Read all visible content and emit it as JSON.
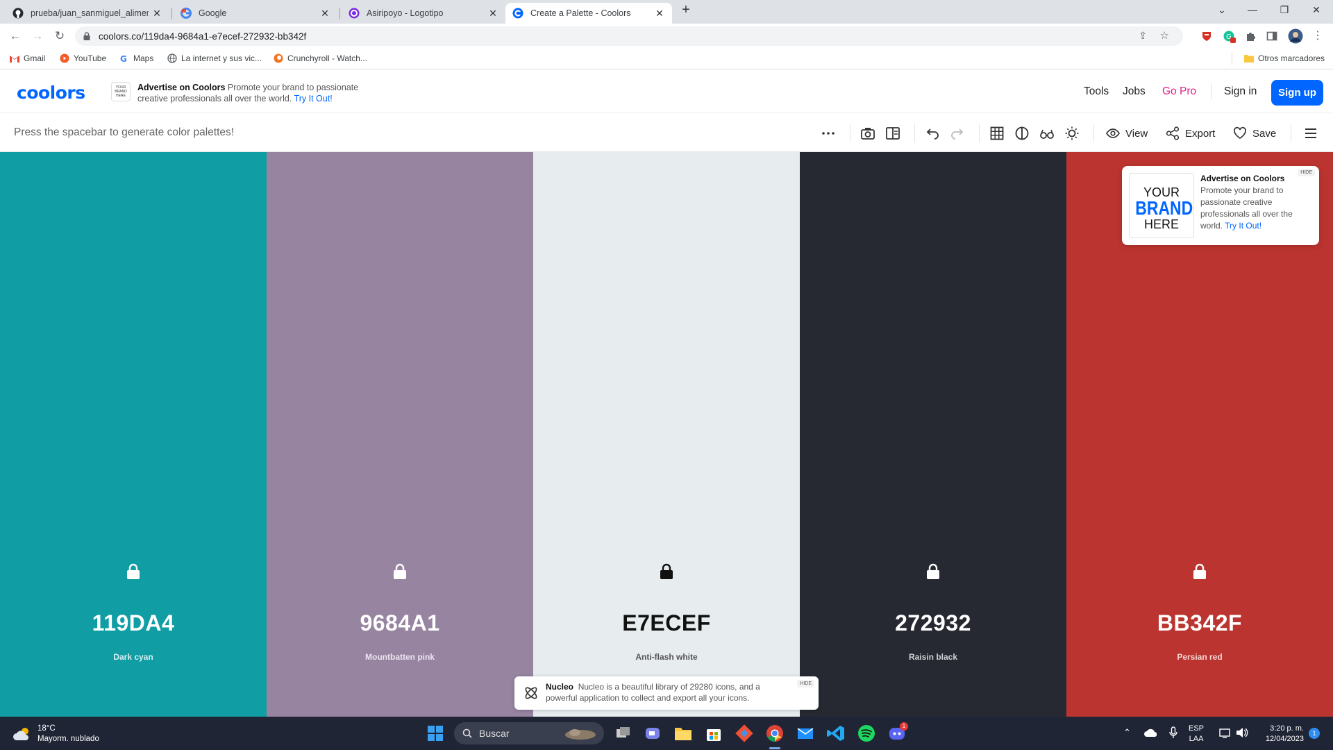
{
  "browser": {
    "tabs": [
      {
        "title": "prueba/juan_sanmiguel_alimentos",
        "icon": "github-icon",
        "active": false
      },
      {
        "title": "Google",
        "icon": "google-icon",
        "active": false
      },
      {
        "title": "Asiripoyo - Logotipo",
        "icon": "canva-icon",
        "active": false
      },
      {
        "title": "Create a Palette - Coolors",
        "icon": "coolors-icon",
        "active": true
      }
    ],
    "new_tab_label": "+",
    "url": "coolors.co/119da4-9684a1-e7ecef-272932-bb342f",
    "bookmarks": [
      {
        "label": "Gmail",
        "icon": "gmail-icon"
      },
      {
        "label": "YouTube",
        "icon": "youtube-icon"
      },
      {
        "label": "Maps",
        "icon": "maps-icon"
      },
      {
        "label": "La internet y sus vic...",
        "icon": "globe-icon"
      },
      {
        "label": "Crunchyroll - Watch...",
        "icon": "crunchyroll-icon"
      }
    ],
    "other_bookmarks": "Otros marcadores"
  },
  "header": {
    "logo": "coolors",
    "ad_box_text": "YOUR BRAND HERE",
    "ad_title": "Advertise on Coolors",
    "ad_text": "Promote your brand to passionate creative professionals all over the world.",
    "ad_link": "Try It Out!",
    "nav": {
      "tools": "Tools",
      "jobs": "Jobs",
      "gopro": "Go Pro",
      "signin": "Sign in",
      "signup": "Sign up"
    }
  },
  "toolbar": {
    "hint": "Press the spacebar to generate color palettes!",
    "view": "View",
    "export": "Export",
    "save": "Save"
  },
  "palette": [
    {
      "hex": "119DA4",
      "name": "Dark cyan",
      "color": "#119da4",
      "text_color": "#ffffff",
      "name_color": "#d8f0f1"
    },
    {
      "hex": "9684A1",
      "name": "Mountbatten pink",
      "color": "#9684a1",
      "text_color": "#ffffff",
      "name_color": "#ece6f0"
    },
    {
      "hex": "E7ECEF",
      "name": "Anti-flash white",
      "color": "#e7ecef",
      "text_color": "#111111",
      "name_color": "#555555"
    },
    {
      "hex": "272932",
      "name": "Raisin black",
      "color": "#272932",
      "text_color": "#ffffff",
      "name_color": "#d0d1d6"
    },
    {
      "hex": "BB342F",
      "name": "Persian red",
      "color": "#bb342f",
      "text_color": "#ffffff",
      "name_color": "#f4d8d6"
    }
  ],
  "ad_card": {
    "logo_line1": "YOUR",
    "logo_line2": "BRAND",
    "logo_line3": "HERE",
    "title": "Advertise on Coolors",
    "text": "Promote your brand to passionate creative professionals all over the world.",
    "link": "Try It Out!",
    "hide": "HIDE"
  },
  "nucleo": {
    "title": "Nucleo",
    "text": "Nucleo is a beautiful library of 29280 icons, and a powerful application to collect and export all your icons.",
    "hide": "HIDE"
  },
  "taskbar": {
    "temp": "18°C",
    "weather": "Mayorm. nublado",
    "search": "Buscar",
    "lang1": "ESP",
    "lang2": "LAA",
    "time": "3:20 p. m.",
    "date": "12/04/2023",
    "notifications": "1",
    "discord_badge": "1"
  }
}
